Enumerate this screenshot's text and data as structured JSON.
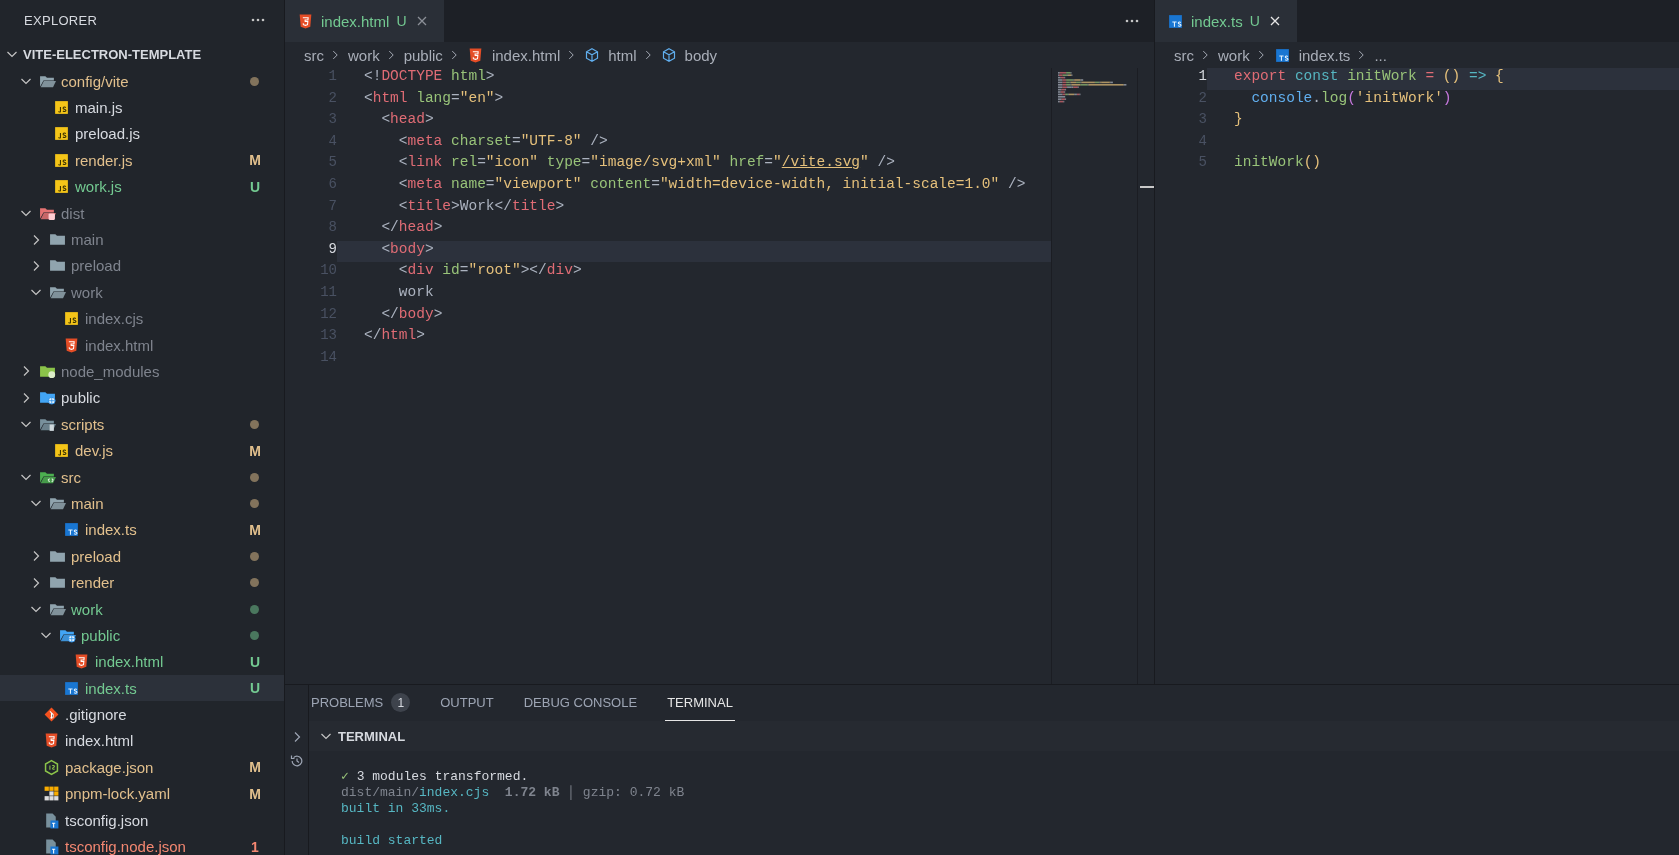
{
  "sidebar": {
    "title": "EXPLORER",
    "root": {
      "label": "VITE-ELECTRON-TEMPLATE",
      "expanded": true,
      "children": [
        {
          "label": "config/vite",
          "kind": "folder",
          "expanded": true,
          "color": "#e2c08d",
          "dot": true,
          "selected": false,
          "children": [
            {
              "label": "main.js",
              "kind": "js",
              "color": "#d7dae0",
              "selected": false
            },
            {
              "label": "preload.js",
              "kind": "js",
              "color": "#d7dae0",
              "selected": false
            },
            {
              "label": "render.js",
              "kind": "js",
              "color": "#e2c08d",
              "badge": "M",
              "selected": false
            },
            {
              "label": "work.js",
              "kind": "js",
              "color": "#73c991",
              "badge": "U",
              "selected": false
            }
          ]
        },
        {
          "label": "dist",
          "kind": "folder-dist",
          "expanded": true,
          "color": "#7f848e",
          "selected": false,
          "children": [
            {
              "label": "main",
              "kind": "folder",
              "expanded": false,
              "color": "#7f848e",
              "selected": false
            },
            {
              "label": "preload",
              "kind": "folder",
              "expanded": false,
              "color": "#7f848e",
              "selected": false
            },
            {
              "label": "work",
              "kind": "folder",
              "expanded": true,
              "color": "#7f848e",
              "selected": false,
              "children": [
                {
                  "label": "index.cjs",
                  "kind": "js",
                  "color": "#7f848e",
                  "selected": false
                },
                {
                  "label": "index.html",
                  "kind": "html",
                  "color": "#7f848e",
                  "selected": false
                }
              ]
            }
          ]
        },
        {
          "label": "node_modules",
          "kind": "folder-node",
          "expanded": false,
          "color": "#7f848e",
          "selected": false
        },
        {
          "label": "public",
          "kind": "folder-public",
          "expanded": false,
          "color": "#d7dae0",
          "selected": false
        },
        {
          "label": "scripts",
          "kind": "folder-scripts",
          "expanded": true,
          "color": "#e2c08d",
          "dot": true,
          "selected": false,
          "children": [
            {
              "label": "dev.js",
              "kind": "js",
              "color": "#e2c08d",
              "badge": "M",
              "selected": false
            }
          ]
        },
        {
          "label": "src",
          "kind": "folder-src",
          "expanded": true,
          "color": "#e2c08d",
          "dot": true,
          "selected": false,
          "children": [
            {
              "label": "main",
              "kind": "folder",
              "expanded": true,
              "color": "#e2c08d",
              "dot": true,
              "selected": false,
              "children": [
                {
                  "label": "index.ts",
                  "kind": "ts",
                  "color": "#e2c08d",
                  "badge": "M",
                  "selected": false
                }
              ]
            },
            {
              "label": "preload",
              "kind": "folder",
              "expanded": false,
              "color": "#e2c08d",
              "dot": true,
              "selected": false
            },
            {
              "label": "render",
              "kind": "folder",
              "expanded": false,
              "color": "#e2c08d",
              "dot": true,
              "selected": false
            },
            {
              "label": "work",
              "kind": "folder",
              "expanded": true,
              "color": "#73c991",
              "dot": true,
              "selected": false,
              "children": [
                {
                  "label": "public",
                  "kind": "folder-public",
                  "expanded": true,
                  "color": "#73c991",
                  "dot": true,
                  "selected": false,
                  "children": [
                    {
                      "label": "index.html",
                      "kind": "html",
                      "color": "#73c991",
                      "badge": "U",
                      "selected": false
                    }
                  ]
                },
                {
                  "label": "index.ts",
                  "kind": "ts",
                  "color": "#73c991",
                  "badge": "U",
                  "selected": true
                }
              ]
            }
          ]
        },
        {
          "label": ".gitignore",
          "kind": "git",
          "color": "#d7dae0",
          "selected": false
        },
        {
          "label": "index.html",
          "kind": "html",
          "color": "#d7dae0",
          "selected": false
        },
        {
          "label": "package.json",
          "kind": "npm",
          "color": "#e2c08d",
          "badge": "M",
          "selected": false
        },
        {
          "label": "pnpm-lock.yaml",
          "kind": "pnpm",
          "color": "#e2c08d",
          "badge": "M",
          "selected": false
        },
        {
          "label": "tsconfig.json",
          "kind": "tsconfig",
          "color": "#d7dae0",
          "selected": false
        },
        {
          "label": "tsconfig.node.json",
          "kind": "tsconfig",
          "color": "#f48771",
          "badge": "1",
          "selected": false
        }
      ]
    }
  },
  "editor_groups": [
    {
      "minimap": true,
      "tabs": [
        {
          "label": "index.html",
          "kind": "html",
          "badge": "U",
          "selected": true
        }
      ],
      "breadcrumbs": [
        {
          "label": "src",
          "kind": "folder"
        },
        {
          "label": "work",
          "kind": "folder"
        },
        {
          "label": "public",
          "kind": "folder"
        },
        {
          "label": "index.html",
          "kind": "html"
        },
        {
          "label": "html",
          "kind": "symbol"
        },
        {
          "label": "body",
          "kind": "symbol"
        }
      ],
      "lines": [
        {
          "number": "1",
          "current": false,
          "tokens": [
            {
              "kind": "punct",
              "text": "<!"
            },
            {
              "kind": "tag",
              "text": "DOCTYPE"
            },
            {
              "kind": "attr",
              "text": " html"
            },
            {
              "kind": "punct",
              "text": ">"
            }
          ]
        },
        {
          "number": "2",
          "current": false,
          "tokens": [
            {
              "kind": "punct",
              "text": "<"
            },
            {
              "kind": "tag",
              "text": "html"
            },
            {
              "kind": "attr",
              "text": " lang"
            },
            {
              "kind": "punct",
              "text": "="
            },
            {
              "kind": "string",
              "text": "\"en\""
            },
            {
              "kind": "punct",
              "text": ">"
            }
          ]
        },
        {
          "number": "3",
          "current": false,
          "tokens": [
            {
              "kind": "punct",
              "text": "  <"
            },
            {
              "kind": "tag",
              "text": "head"
            },
            {
              "kind": "punct",
              "text": ">"
            }
          ]
        },
        {
          "number": "4",
          "current": false,
          "tokens": [
            {
              "kind": "punct",
              "text": "    <"
            },
            {
              "kind": "tag",
              "text": "meta"
            },
            {
              "kind": "attr",
              "text": " charset"
            },
            {
              "kind": "punct",
              "text": "="
            },
            {
              "kind": "string",
              "text": "\"UTF-8\""
            },
            {
              "kind": "punct",
              "text": " />"
            }
          ]
        },
        {
          "number": "5",
          "current": false,
          "tokens": [
            {
              "kind": "punct",
              "text": "    <"
            },
            {
              "kind": "tag",
              "text": "link"
            },
            {
              "kind": "attr",
              "text": " rel"
            },
            {
              "kind": "punct",
              "text": "="
            },
            {
              "kind": "string",
              "text": "\"icon\""
            },
            {
              "kind": "attr",
              "text": " type"
            },
            {
              "kind": "punct",
              "text": "="
            },
            {
              "kind": "string",
              "text": "\"image/svg+xml\""
            },
            {
              "kind": "attr",
              "text": " href"
            },
            {
              "kind": "punct",
              "text": "="
            },
            {
              "kind": "string",
              "text": "\""
            },
            {
              "kind": "link",
              "text": "/vite.svg"
            },
            {
              "kind": "string",
              "text": "\""
            },
            {
              "kind": "punct",
              "text": " />"
            }
          ]
        },
        {
          "number": "6",
          "current": false,
          "tokens": [
            {
              "kind": "punct",
              "text": "    <"
            },
            {
              "kind": "tag",
              "text": "meta"
            },
            {
              "kind": "attr",
              "text": " name"
            },
            {
              "kind": "punct",
              "text": "="
            },
            {
              "kind": "string",
              "text": "\"viewport\""
            },
            {
              "kind": "attr",
              "text": " content"
            },
            {
              "kind": "punct",
              "text": "="
            },
            {
              "kind": "string",
              "text": "\"width=device-width, initial-scale=1.0\""
            },
            {
              "kind": "punct",
              "text": " />"
            }
          ]
        },
        {
          "number": "7",
          "current": false,
          "tokens": [
            {
              "kind": "punct",
              "text": "    <"
            },
            {
              "kind": "tag",
              "text": "title"
            },
            {
              "kind": "punct",
              "text": ">"
            },
            {
              "kind": "text",
              "text": "Work"
            },
            {
              "kind": "punct",
              "text": "</"
            },
            {
              "kind": "tag",
              "text": "title"
            },
            {
              "kind": "punct",
              "text": ">"
            }
          ]
        },
        {
          "number": "8",
          "current": false,
          "tokens": [
            {
              "kind": "punct",
              "text": "  </"
            },
            {
              "kind": "tag",
              "text": "head"
            },
            {
              "kind": "punct",
              "text": ">"
            }
          ]
        },
        {
          "number": "9",
          "current": true,
          "tokens": [
            {
              "kind": "punct",
              "text": "  <"
            },
            {
              "kind": "tag",
              "text": "body"
            },
            {
              "kind": "punct",
              "text": ">"
            }
          ]
        },
        {
          "number": "10",
          "current": false,
          "tokens": [
            {
              "kind": "punct",
              "text": "    <"
            },
            {
              "kind": "tag",
              "text": "div"
            },
            {
              "kind": "attr",
              "text": " id"
            },
            {
              "kind": "punct",
              "text": "="
            },
            {
              "kind": "string",
              "text": "\"root\""
            },
            {
              "kind": "punct",
              "text": "></"
            },
            {
              "kind": "tag",
              "text": "div"
            },
            {
              "kind": "punct",
              "text": ">"
            }
          ]
        },
        {
          "number": "11",
          "current": false,
          "tokens": [
            {
              "kind": "text",
              "text": "    work"
            }
          ]
        },
        {
          "number": "12",
          "current": false,
          "tokens": [
            {
              "kind": "punct",
              "text": "  </"
            },
            {
              "kind": "tag",
              "text": "body"
            },
            {
              "kind": "punct",
              "text": ">"
            }
          ]
        },
        {
          "number": "13",
          "current": false,
          "tokens": [
            {
              "kind": "punct",
              "text": "</"
            },
            {
              "kind": "tag",
              "text": "html"
            },
            {
              "kind": "punct",
              "text": ">"
            }
          ]
        },
        {
          "number": "14",
          "current": false
        }
      ]
    },
    {
      "tabs": [
        {
          "label": "index.ts",
          "kind": "ts",
          "badge": "U",
          "selected": true
        }
      ],
      "breadcrumbs": [
        {
          "label": "src",
          "kind": "folder"
        },
        {
          "label": "work",
          "kind": "folder"
        },
        {
          "label": "index.ts",
          "kind": "ts"
        },
        {
          "label": "...",
          "kind": "more"
        }
      ],
      "lines": [
        {
          "number": "1",
          "current": true,
          "tokens": [
            {
              "kind": "tag",
              "text": "export"
            },
            {
              "kind": "storage",
              "text": " const"
            },
            {
              "kind": "func",
              "text": " initWork"
            },
            {
              "kind": "tag",
              "text": " ="
            },
            {
              "kind": "paren",
              "text": " ()"
            },
            {
              "kind": "storage",
              "text": " =>"
            },
            {
              "kind": "paren",
              "text": " {"
            }
          ]
        },
        {
          "number": "2",
          "current": false,
          "tokens": [
            {
              "kind": "builtin",
              "text": "  console"
            },
            {
              "kind": "text",
              "text": "."
            },
            {
              "kind": "func",
              "text": "log"
            },
            {
              "kind": "paren2",
              "text": "("
            },
            {
              "kind": "string",
              "text": "'initWork'"
            },
            {
              "kind": "paren2",
              "text": ")"
            }
          ]
        },
        {
          "number": "3",
          "current": false,
          "tokens": [
            {
              "kind": "paren",
              "text": "}"
            }
          ]
        },
        {
          "number": "4",
          "current": false
        },
        {
          "number": "5",
          "current": false,
          "tokens": [
            {
              "kind": "func",
              "text": "initWork"
            },
            {
              "kind": "paren",
              "text": "()"
            }
          ]
        }
      ]
    }
  ],
  "panel": {
    "tabs": [
      {
        "label": "PROBLEMS",
        "badge": "1",
        "selected": false
      },
      {
        "label": "OUTPUT",
        "selected": false
      },
      {
        "label": "DEBUG CONSOLE",
        "selected": false
      },
      {
        "label": "TERMINAL",
        "selected": true
      }
    ],
    "section": {
      "title": "TERMINAL",
      "expanded": true
    },
    "terminal": [
      {
        "lines": [
          {
            "tokens": [
              {
                "kind": "ok",
                "text": "✓"
              },
              {
                "kind": "text",
                "text": " 3 modules transformed."
              }
            ]
          },
          {
            "tokens": [
              {
                "kind": "dim",
                "text": "dist/main/"
              },
              {
                "kind": "cyan",
                "text": "index.cjs"
              },
              {
                "kind": "bold",
                "text": "  1.72 kB"
              },
              {
                "kind": "dim",
                "text": " │ gzip: 0.72 kB"
              }
            ]
          },
          {
            "tokens": [
              {
                "kind": "cyan",
                "text": "built in 33ms."
              }
            ]
          }
        ]
      },
      {
        "lines": [
          {
            "tokens": [
              {
                "kind": "cyan",
                "text": "build started"
              }
            ]
          }
        ]
      }
    ]
  }
}
